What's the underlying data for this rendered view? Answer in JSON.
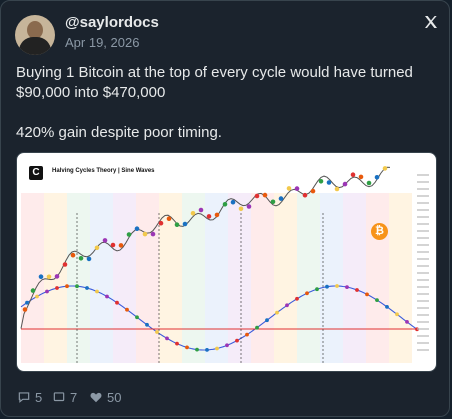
{
  "author": {
    "handle": "@saylordocs",
    "date": "Apr 19, 2026"
  },
  "tweet": {
    "line1": "Buying 1 Bitcoin at the top of every cycle would have turned",
    "line2": "$90,000 into $470,000",
    "line3": "420% gain despite poor timing."
  },
  "media": {
    "logo_glyph": "C",
    "title": "Halving Cycles Theory | Sine Waves",
    "btc_glyph": "₿",
    "colors": {
      "price": "#555555",
      "sine": "#3b5bdb",
      "baseline": "#e03131",
      "halving": "#222222"
    }
  },
  "actions": {
    "replies": "5",
    "reposts": "7",
    "likes": "50"
  },
  "icons": {
    "reply": "reply-icon",
    "repost": "repost-icon",
    "like": "heart-icon",
    "brand": "x-logo-icon"
  }
}
